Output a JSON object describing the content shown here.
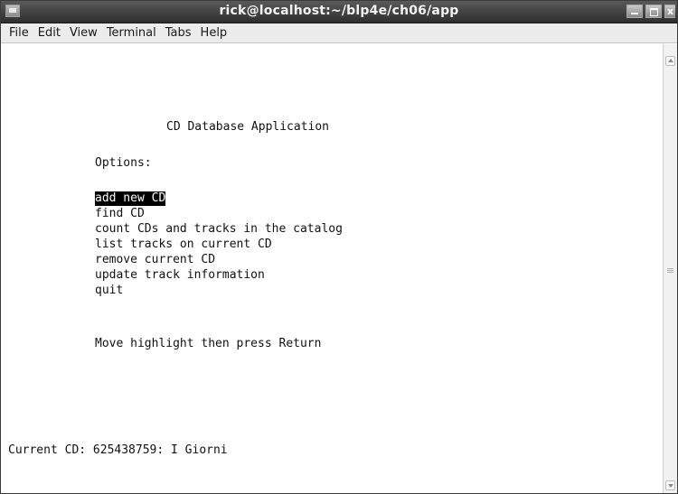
{
  "window": {
    "title": "rick@localhost:~/blp4e/ch06/app"
  },
  "menubar": {
    "items": [
      "File",
      "Edit",
      "View",
      "Terminal",
      "Tabs",
      "Help"
    ]
  },
  "terminal": {
    "heading": "CD Database Application",
    "options_label": "Options:",
    "options": [
      "add new CD",
      "find CD",
      "count CDs and tracks in the catalog",
      "list tracks on current CD",
      "remove current CD",
      "update track information",
      "quit"
    ],
    "selected_option": "add new CD",
    "instruction": "Move highlight then press Return",
    "status": "Current CD: 625438759: I Giorni"
  },
  "icons": {
    "window_menu": "window-menu-icon",
    "minimize": "minimize-icon",
    "maximize": "maximize-icon",
    "close": "close-icon",
    "scroll_up": "scroll-up-arrow-icon",
    "scroll_down": "scroll-down-arrow-icon"
  },
  "colors": {
    "titlebar": "#3e3e3e",
    "highlight_bg": "#000000",
    "highlight_fg": "#ffffff"
  }
}
